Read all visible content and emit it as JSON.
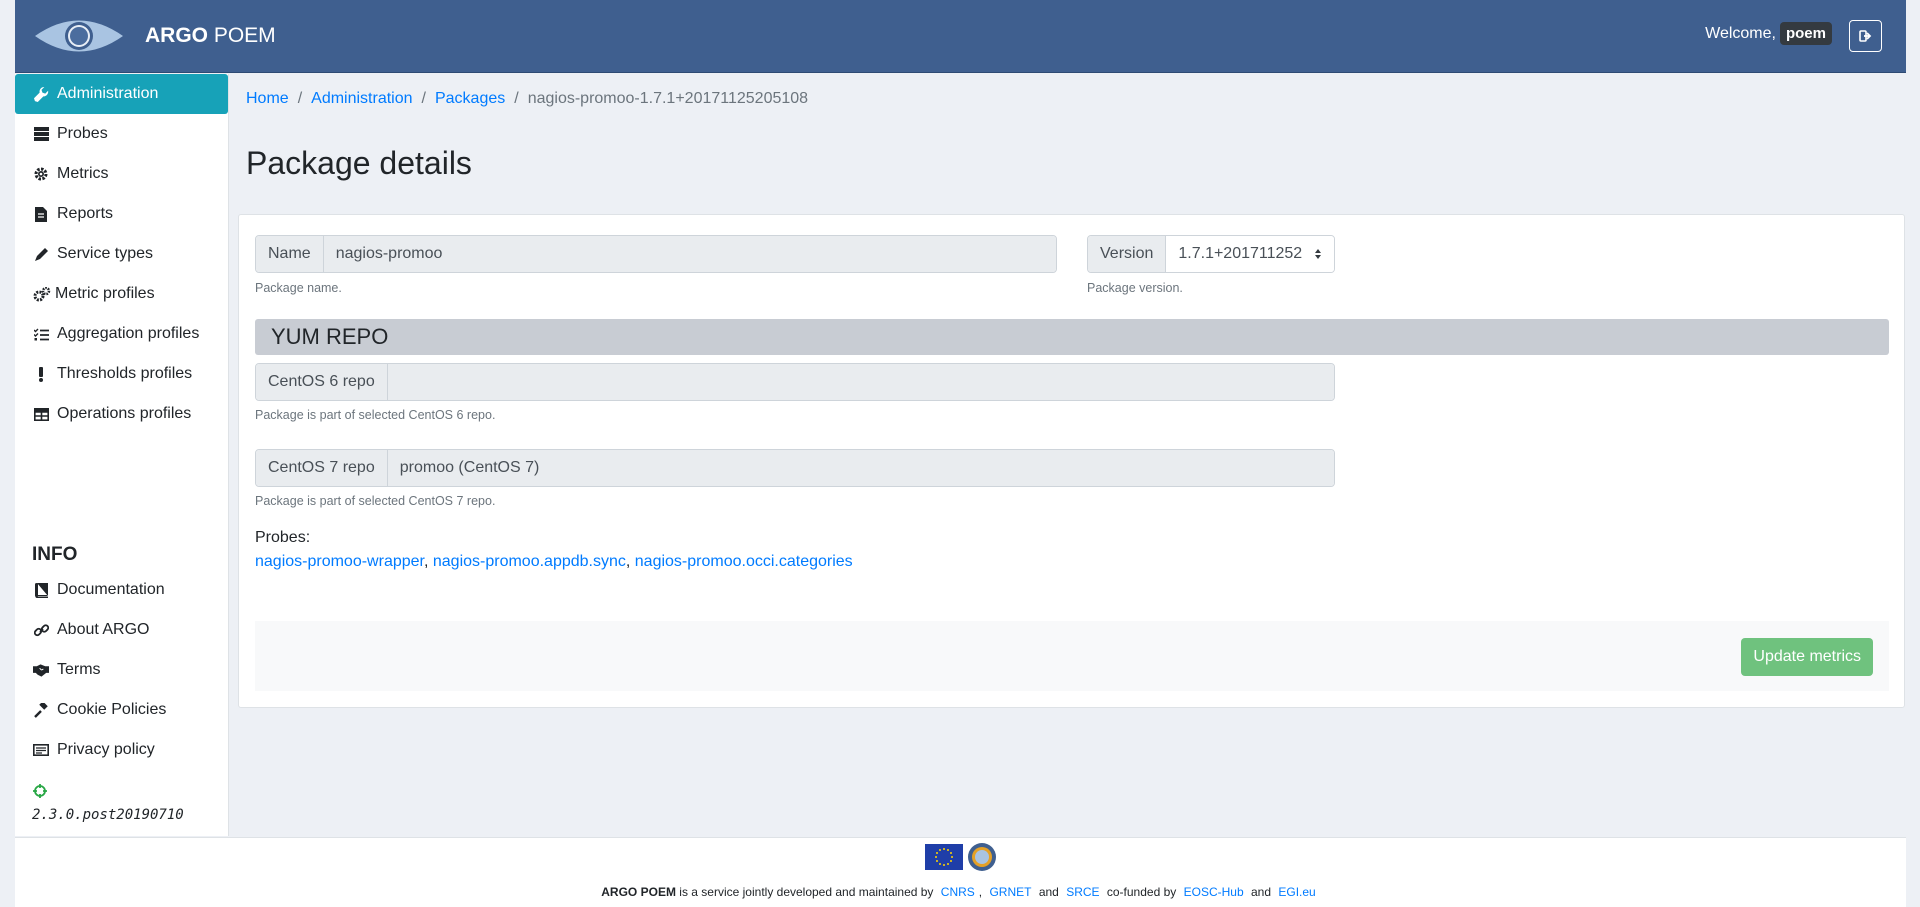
{
  "header": {
    "brand_bold": "ARGO",
    "brand_rest": " POEM",
    "welcome": "Welcome,",
    "username": "poem"
  },
  "sidebar": {
    "items": [
      {
        "label": "Administration",
        "icon": "wrench-icon"
      },
      {
        "label": "Probes",
        "icon": "server-icon"
      },
      {
        "label": "Metrics",
        "icon": "gear-icon"
      },
      {
        "label": "Reports",
        "icon": "file-icon"
      },
      {
        "label": "Service types",
        "icon": "pen-icon"
      },
      {
        "label": "Metric profiles",
        "icon": "gears-icon"
      },
      {
        "label": "Aggregation profiles",
        "icon": "list-check-icon"
      },
      {
        "label": "Thresholds profiles",
        "icon": "exclamation-icon"
      },
      {
        "label": "Operations profiles",
        "icon": "table-icon"
      }
    ],
    "info_title": "INFO",
    "info_items": [
      {
        "label": "Documentation",
        "icon": "book-icon"
      },
      {
        "label": "About ARGO",
        "icon": "link-icon"
      },
      {
        "label": "Terms",
        "icon": "handshake-icon"
      },
      {
        "label": "Cookie Policies",
        "icon": "gavel-icon"
      },
      {
        "label": "Privacy policy",
        "icon": "id-card-icon"
      }
    ],
    "version": "2.3.0.post20190710"
  },
  "breadcrumb": {
    "home": "Home",
    "administration": "Administration",
    "packages": "Packages",
    "current": "nagios-promoo-1.7.1+20171125205108"
  },
  "page_title": "Package details",
  "form": {
    "name_label": "Name",
    "name_value": "nagios-promoo",
    "name_help": "Package name.",
    "version_label": "Version",
    "version_value": "1.7.1+201711252",
    "version_help": "Package version.",
    "section_title": "YUM REPO",
    "centos6_label": "CentOS 6 repo",
    "centos6_value": "",
    "centos6_help": "Package is part of selected CentOS 6 repo.",
    "centos7_label": "CentOS 7 repo",
    "centos7_value": "promoo (CentOS 7)",
    "centos7_help": "Package is part of selected CentOS 7 repo.",
    "probes_label": "Probes:",
    "probes": [
      "nagios-promoo-wrapper",
      "nagios-promoo.appdb.sync",
      "nagios-promoo.occi.categories"
    ],
    "update_button": "Update metrics"
  },
  "footer": {
    "brand": "ARGO POEM",
    "text1": "is a service jointly developed and maintained by",
    "cnrs": "CNRS",
    "grnet": "GRNET",
    "and1": "and",
    "srce": "SRCE",
    "cofunded": "co-funded by",
    "eosc": "EOSC-Hub",
    "and2": "and",
    "egi": "EGI.eu"
  }
}
